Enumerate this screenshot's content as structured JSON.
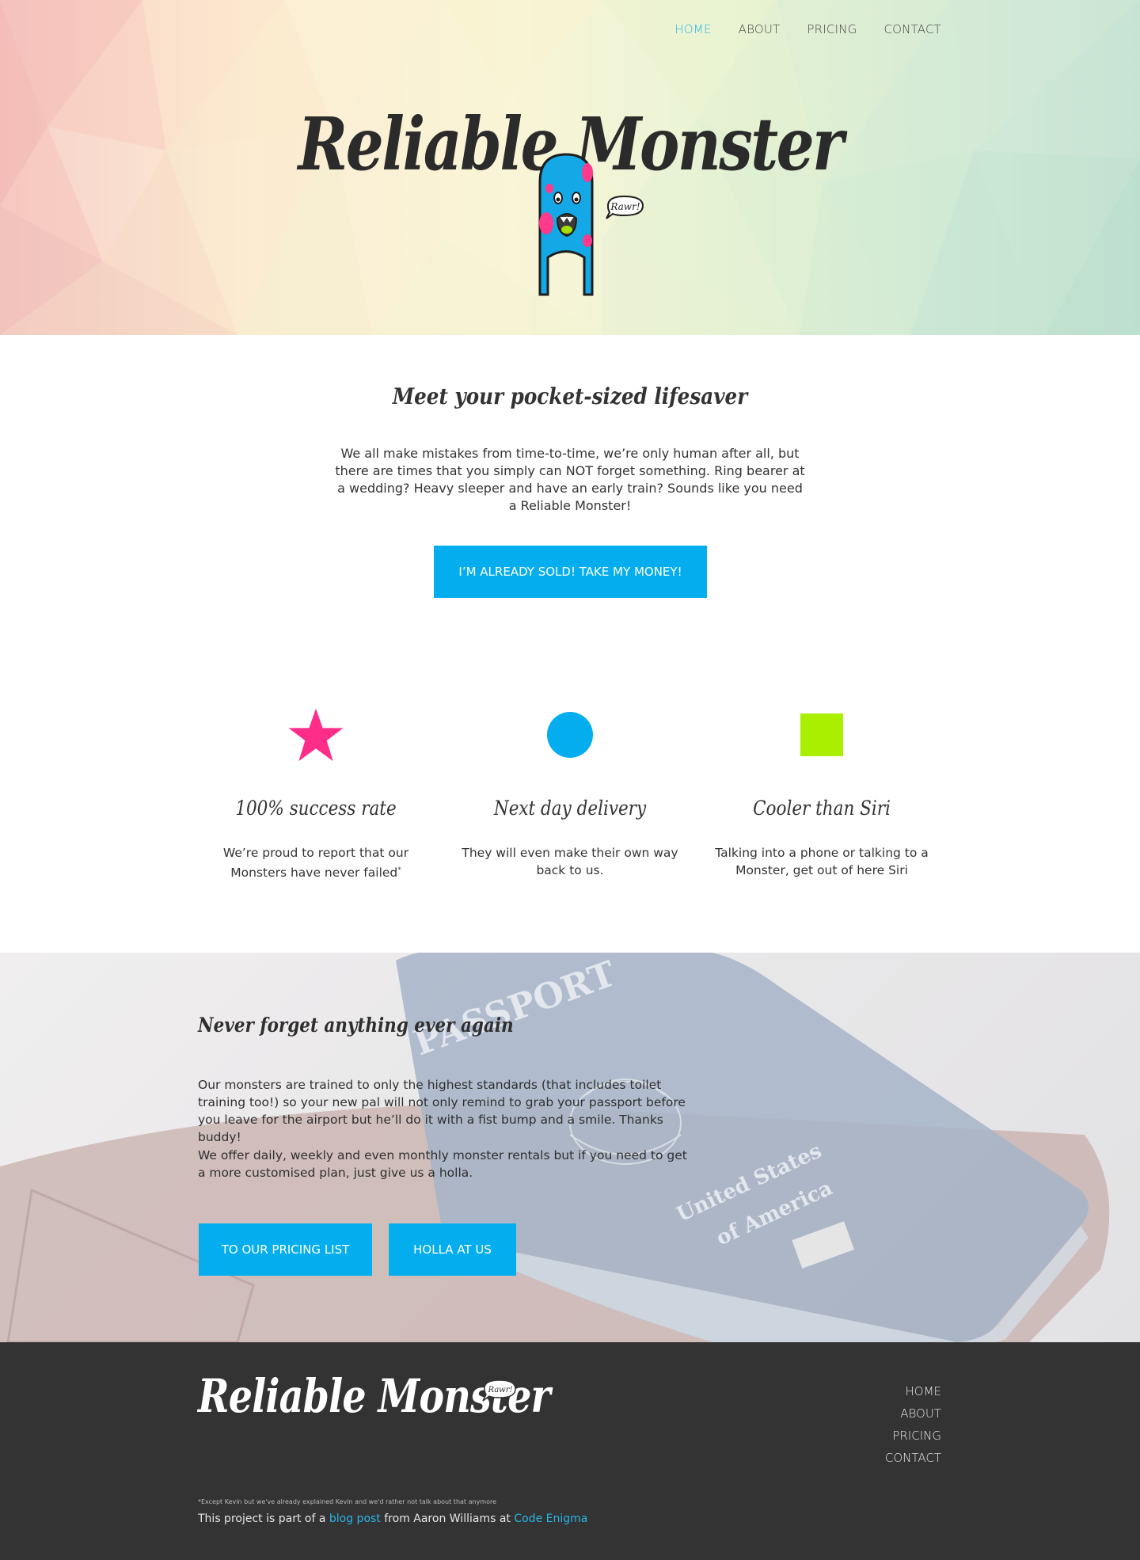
{
  "nav": {
    "items": [
      {
        "label": "HOME",
        "active": true
      },
      {
        "label": "ABOUT",
        "active": false
      },
      {
        "label": "PRICING",
        "active": false
      },
      {
        "label": "CONTACT",
        "active": false
      }
    ]
  },
  "hero": {
    "title": "Reliable Monster",
    "bubble": "Rawr!"
  },
  "intro": {
    "heading": "Meet your pocket-sized lifesaver",
    "text": "We all make mistakes from time-to-time, we’re only human after all, but there are times that you simply can NOT forget something. Ring bearer at a wedding? Heavy sleeper and have an early train? Sounds like you need a Reliable Monster!",
    "cta": "I’M ALREADY SOLD! TAKE MY MONEY!"
  },
  "features": [
    {
      "icon": "star-icon",
      "color": "#ff2d8a",
      "title": "100% success rate",
      "text": "We’re proud to report that our Monsters have never failed",
      "mark": "*"
    },
    {
      "icon": "circle-icon",
      "color": "#04aeee",
      "title": "Next day delivery",
      "text": "They will even make their own way back to us.",
      "mark": ""
    },
    {
      "icon": "square-icon",
      "color": "#aaee00",
      "title": "Cooler than Siri",
      "text": "Talking into a phone or talking to a Monster, get out of here Siri",
      "mark": ""
    }
  ],
  "passport_section": {
    "heading": "Never forget anything ever again",
    "text1": "Our monsters are trained to only the highest standards (that includes toilet training too!) so your new pal will not only remind to grab your passport before you leave for the airport but he’ll do it with a fist bump and a smile. Thanks buddy!",
    "text2": "We offer daily, weekly and even monthly monster rentals but if you need to get a more customised plan, just give us a holla.",
    "btn_pricing": "TO OUR PRICING LIST",
    "btn_holla": "HOLLA AT US",
    "image_text": {
      "passport": "PASSPORT",
      "country1": "United States",
      "country2": "of America"
    }
  },
  "footer": {
    "logo": "Reliable Monster",
    "bubble": "Rawr!",
    "nav": [
      "HOME",
      "ABOUT",
      "PRICING",
      "CONTACT"
    ],
    "footnote": "*Except Kevin but we've already explained Kevin and we'd rather not talk about that anymore",
    "credit_prefix": "This project is part of a ",
    "credit_link1": "blog post",
    "credit_mid": " from Aaron Williams at ",
    "credit_link2": "Code Enigma"
  },
  "colors": {
    "accent": "#04aeee",
    "footer_bg": "#333333",
    "nav_active": "#2ab4e6"
  }
}
